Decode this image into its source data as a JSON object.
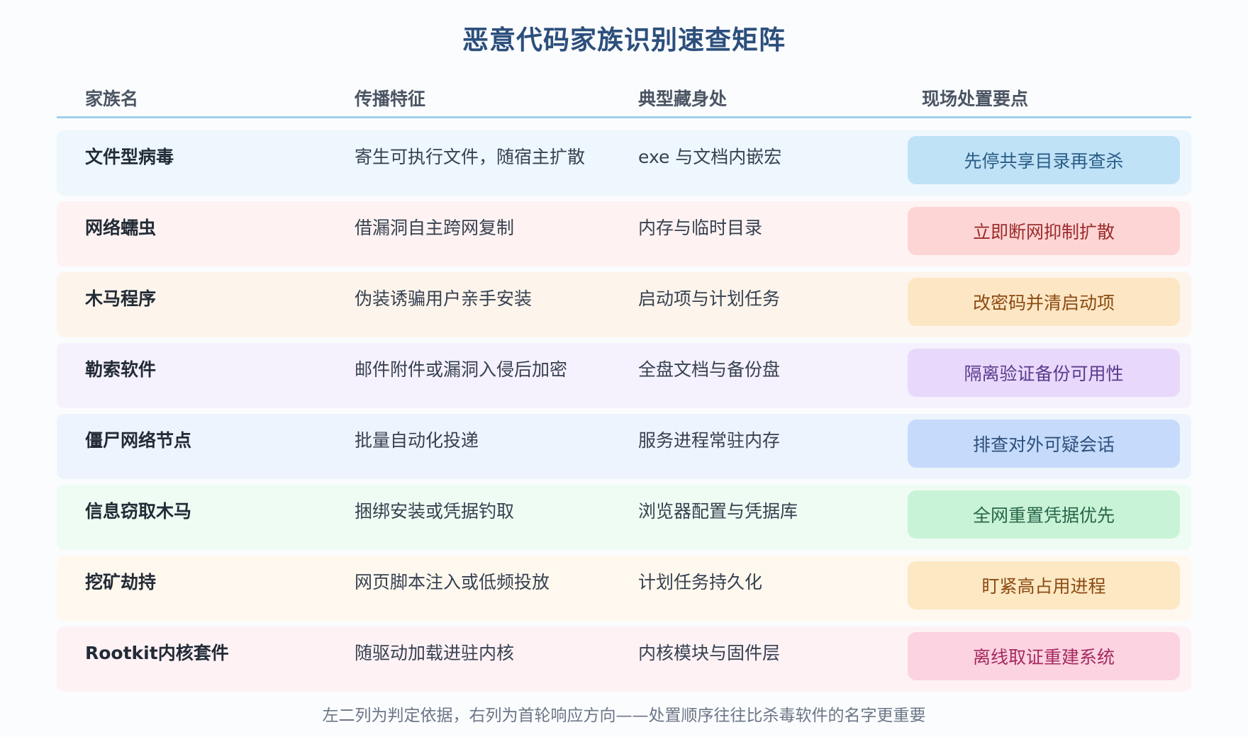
{
  "title": "恶意代码家族识别速查矩阵",
  "columns": [
    "家族名",
    "传播特征",
    "典型藏身处",
    "现场处置要点"
  ],
  "rows": [
    {
      "name": "文件型病毒",
      "spread": "寄生可执行文件，随宿主扩散",
      "hideout": "exe 与文档内嵌宏",
      "action": "先停共享目录再查杀",
      "row_bg": "#edf7fd",
      "pill_bg": "#bfe2f7",
      "pill_fg": "#2a5d86"
    },
    {
      "name": "网络蠕虫",
      "spread": "借漏洞自主跨网复制",
      "hideout": "内存与临时目录",
      "action": "立即断网抑制扩散",
      "row_bg": "#fef3f2",
      "pill_bg": "#fdd5d4",
      "pill_fg": "#9b2c2c"
    },
    {
      "name": "木马程序",
      "spread": "伪装诱骗用户亲手安装",
      "hideout": "启动项与计划任务",
      "action": "改密码并清启动项",
      "row_bg": "#fdf5ec",
      "pill_bg": "#fde6c4",
      "pill_fg": "#8a4b12"
    },
    {
      "name": "勒索软件",
      "spread": "邮件附件或漏洞入侵后加密",
      "hideout": "全盘文档与备份盘",
      "action": "隔离验证备份可用性",
      "row_bg": "#f5f1fd",
      "pill_bg": "#e8d9fc",
      "pill_fg": "#5b3a8c"
    },
    {
      "name": "僵尸网络节点",
      "spread": "批量自动化投递",
      "hideout": "服务进程常驻内存",
      "action": "排查对外可疑会话",
      "row_bg": "#eef4fd",
      "pill_bg": "#c6dbfb",
      "pill_fg": "#2c4f7c"
    },
    {
      "name": "信息窃取木马",
      "spread": "捆绑安装或凭据钓取",
      "hideout": "浏览器配置与凭据库",
      "action": "全网重置凭据优先",
      "row_bg": "#effcf3",
      "pill_bg": "#c9f3d7",
      "pill_fg": "#27664a"
    },
    {
      "name": "挖矿劫持",
      "spread": "网页脚本注入或低频投放",
      "hideout": "计划任务持久化",
      "action": "盯紧高占用进程",
      "row_bg": "#fef8ee",
      "pill_bg": "#fde8c4",
      "pill_fg": "#8a4b12"
    },
    {
      "name": "Rootkit内核套件",
      "spread": "随驱动加载进驻内核",
      "hideout": "内核模块与固件层",
      "action": "离线取证重建系统",
      "row_bg": "#fef2f5",
      "pill_bg": "#fcd3e1",
      "pill_fg": "#a5295f"
    }
  ],
  "footer": "左二列为判定依据，右列为首轮响应方向——处置顺序往往比杀毒软件的名字更重要"
}
